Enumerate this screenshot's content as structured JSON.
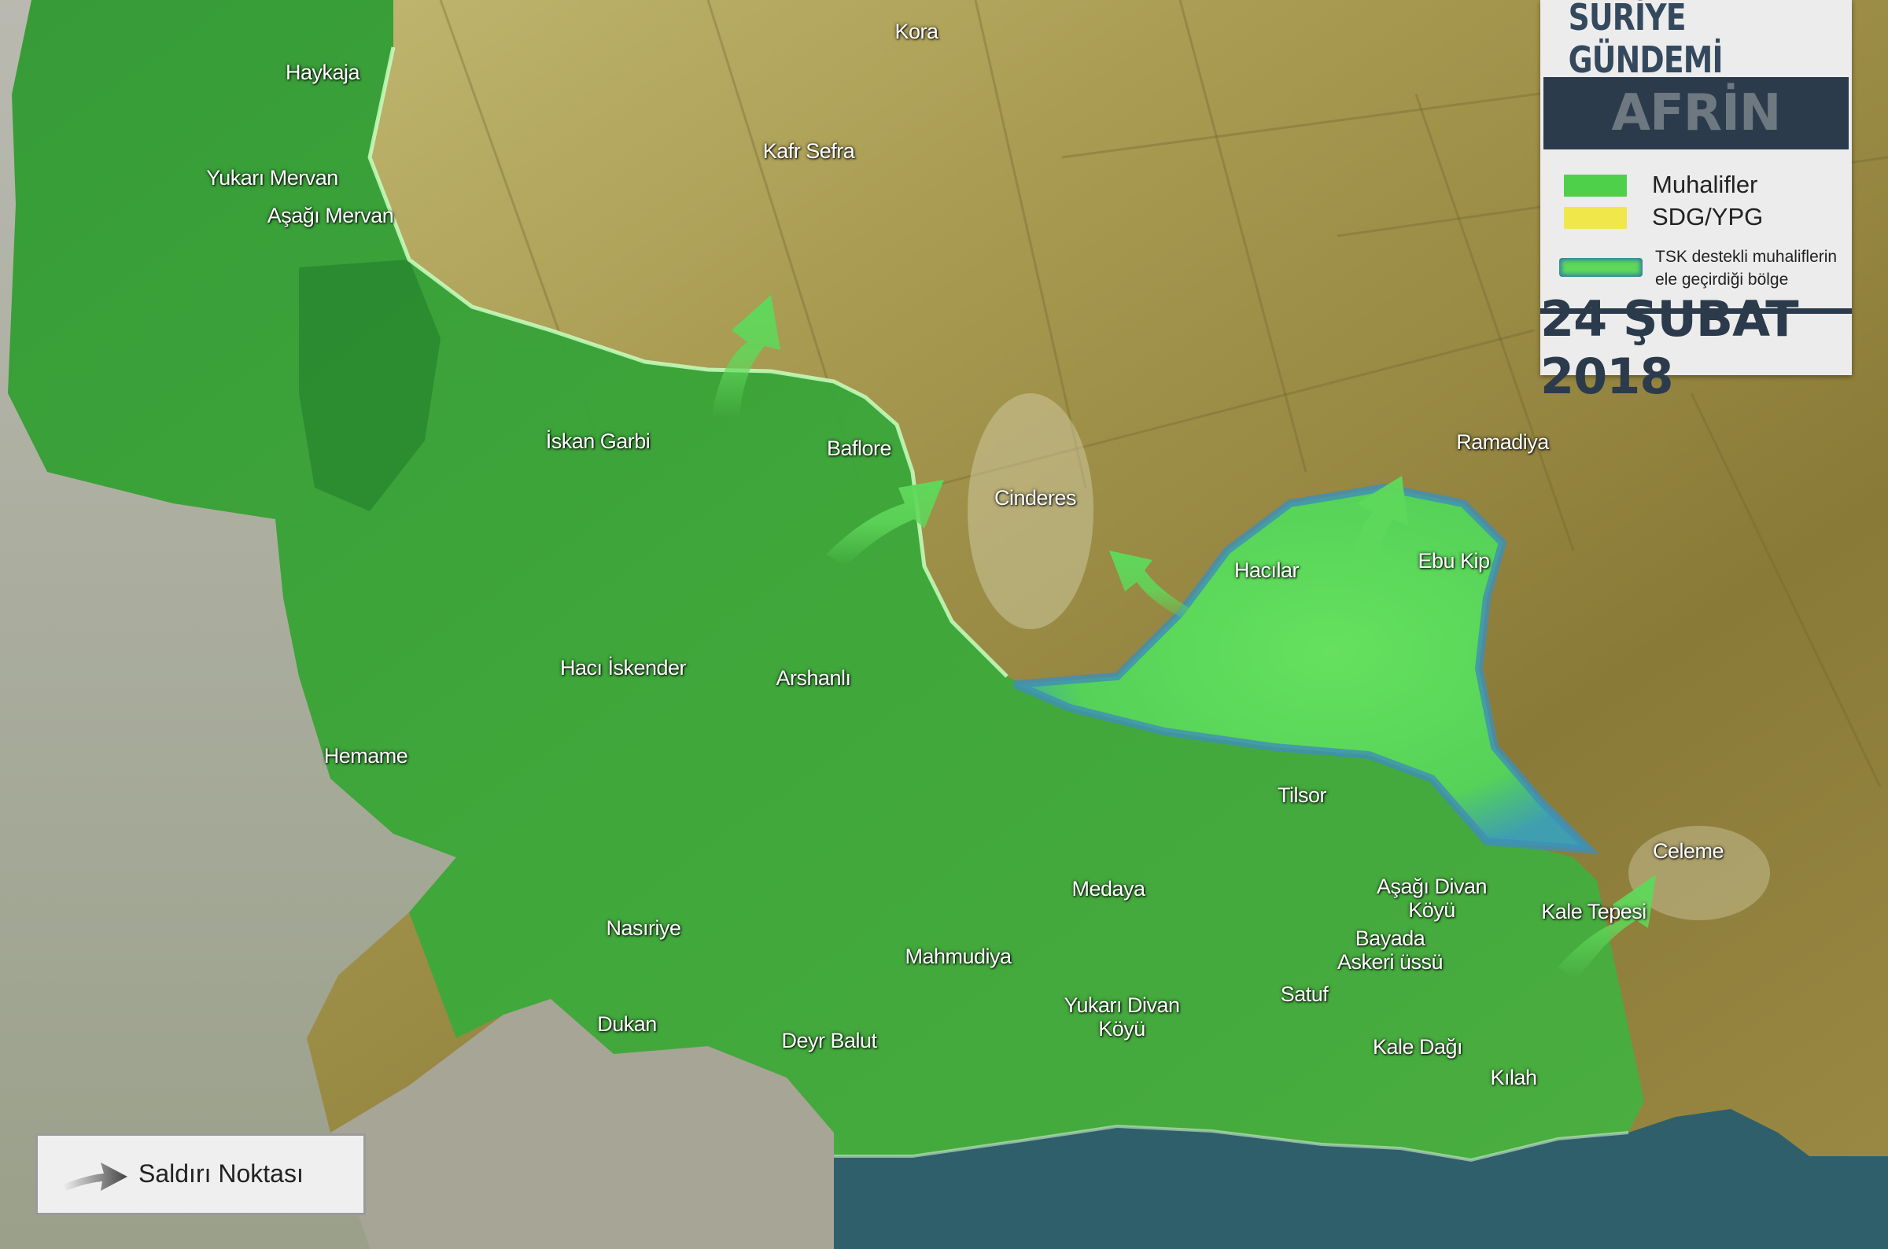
{
  "legend": {
    "brand": "SURİYE GÜNDEMİ",
    "region": "AFRİN",
    "items": [
      {
        "label": "Muhalifler",
        "color": "#4fd04a"
      },
      {
        "label": "SDG/YPG",
        "color": "#f0e84a"
      }
    ],
    "captured_note": "TSK destekli muhaliflerin\nele geçirdiği bölge",
    "captured_colors": {
      "fill": "#5fd85a",
      "edge": "#2e7fa8"
    },
    "date": "24 ŞUBAT 2018"
  },
  "attack_legend": {
    "label": "Saldırı Noktası"
  },
  "colors": {
    "opposition": "#3fae3a",
    "sdg_terrain": "#9a8a40",
    "water": "#2f5f6a",
    "plain": "#a9a89a",
    "arrow": "#5fd85a"
  },
  "places": [
    "Kora",
    "Haykaja",
    "Kafr Sefra",
    "Yukarı Mervan",
    "Aşağı Mervan",
    "İskan Garbi",
    "Baflore",
    "Cinderes",
    "Ramadiya",
    "Hacılar",
    "Ebu Kip",
    "Hacı İskender",
    "Arshanlı",
    "Hemame",
    "Tilsor",
    "Celeme",
    "Medaya",
    "Aşağı Divan\nKöyü",
    "Kale Tepesi",
    "Bayada\nAskeri üssü",
    "Nasıriye",
    "Mahmudiya",
    "Yukarı Divan\nKöyü",
    "Satuf",
    "Dukan",
    "Deyr Balut",
    "Kale Dağı",
    "Kılah"
  ]
}
